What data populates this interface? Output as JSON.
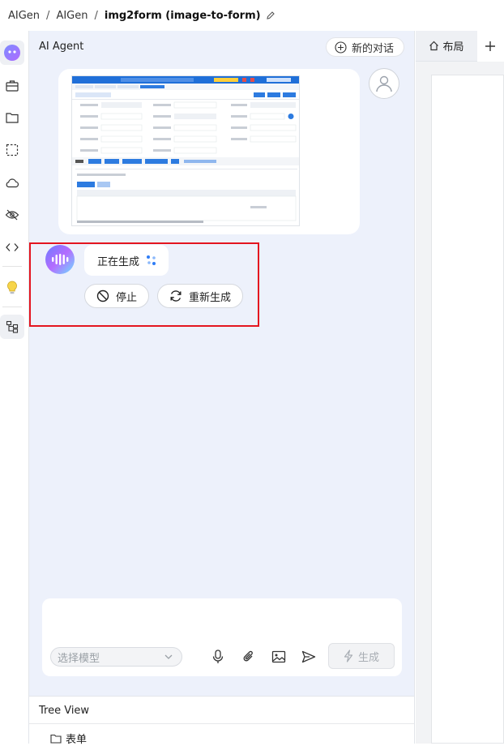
{
  "breadcrumb": {
    "items": [
      "AIGen",
      "AIGen"
    ],
    "current": "img2form (image-to-form)"
  },
  "agent": {
    "title": "AI Agent",
    "new_chat_label": "新的对话",
    "status_label": "正在生成",
    "stop_label": "停止",
    "regenerate_label": "重新生成"
  },
  "input": {
    "model_placeholder": "选择模型",
    "generate_label": "生成"
  },
  "tree": {
    "title": "Tree View",
    "items": [
      "表单"
    ]
  },
  "right": {
    "tab_label": "布局"
  },
  "colors": {
    "highlight": "#e4151f",
    "panel_bg": "#edf1fb",
    "accent": "#1e6ff1"
  }
}
